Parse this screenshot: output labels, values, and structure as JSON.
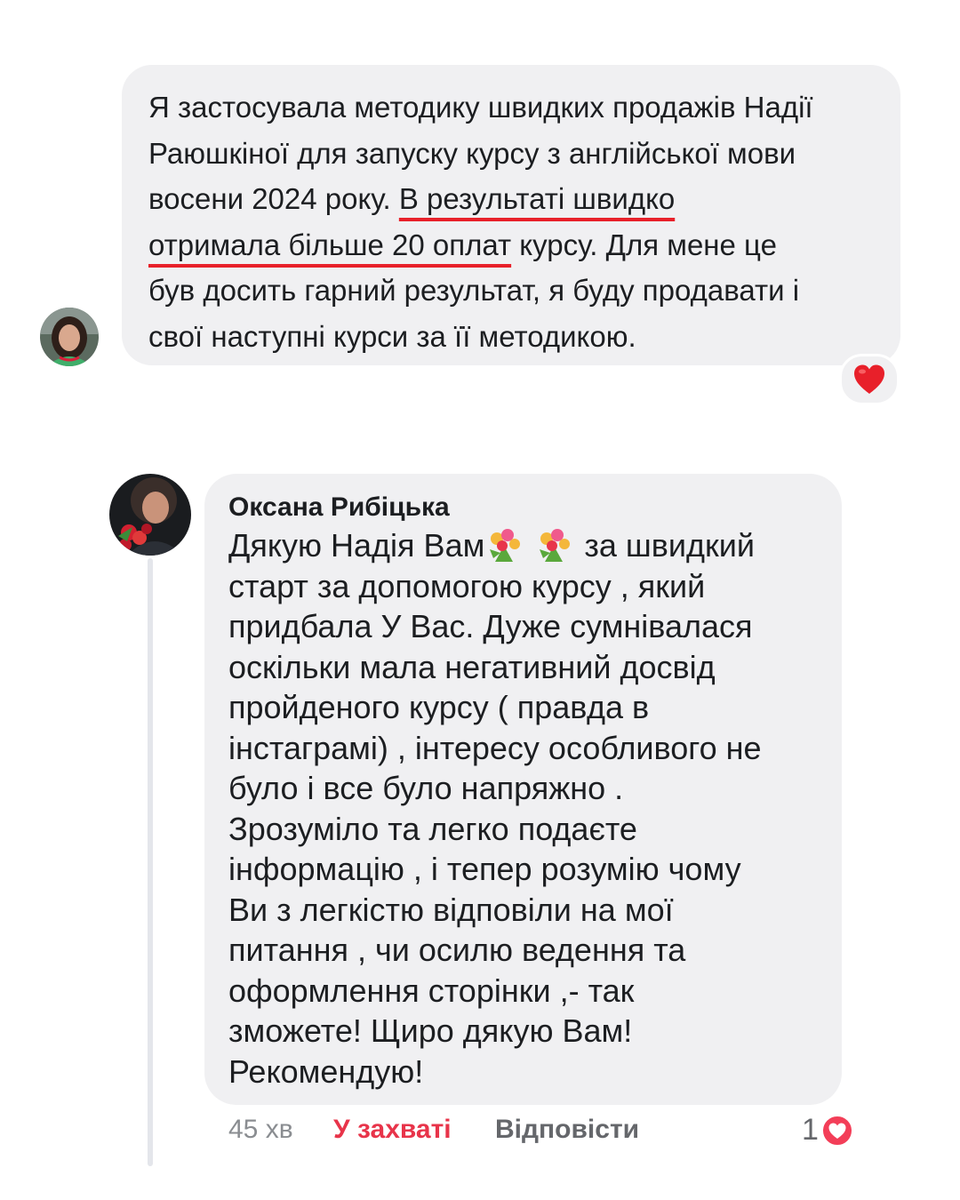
{
  "message1": {
    "lines": [
      "Я застосувала методику швидких продажів Надії",
      "Раюшкіної для запуску курсу з англійської мови",
      "восени 2024 року. ",
      "В результаті швидко",
      "отримала більше 20 оплат",
      " курсу. Для мене це",
      "був досить гарний результат, я буду продавати і",
      "свої наступні курси за її методикою."
    ],
    "reaction": "heart"
  },
  "comment": {
    "author": "Оксана Рибіцька",
    "first_line_start": "Дякую Надія Вам",
    "first_line_end": "  за швидкий",
    "lines": [
      "старт за допомогою курсу , який",
      "придбала У Вас. Дуже сумнівалася",
      "оскільки мала негативний досвід",
      "пройденого курсу ( правда в",
      "інстаграмі) , інтересу особливого не",
      "було і все було напряжно .",
      "Зрозуміло та легко подаєте",
      "інформацію , і тепер розумію чому",
      "Ви з легкістю відповіли на мої",
      "питання , чи осилю ведення та",
      "оформлення сторінки ,- так",
      "зможете! Щиро дякую Вам!",
      "Рекомендую!"
    ],
    "time": "45 хв",
    "like_label": "У захваті",
    "reply_label": "Відповісти",
    "reaction_count": "1",
    "accent_color": "#e8344a"
  }
}
